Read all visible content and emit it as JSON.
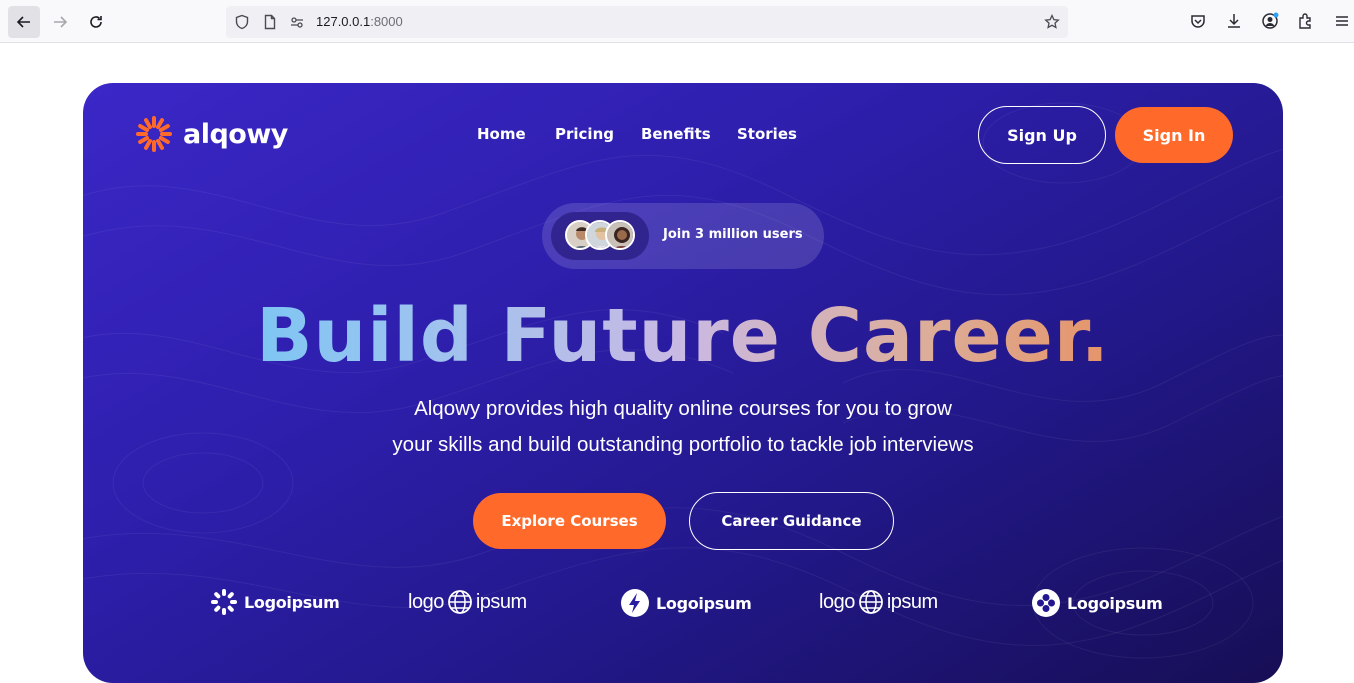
{
  "browser": {
    "url_host": "127.0.0.1",
    "url_port": ":8000"
  },
  "brand": {
    "name": "alqowy",
    "accent": "#ff6a2b"
  },
  "nav": {
    "items": [
      "Home",
      "Pricing",
      "Benefits",
      "Stories"
    ]
  },
  "auth": {
    "signup": "Sign Up",
    "signin": "Sign In"
  },
  "badge": {
    "text": "Join 3 million users"
  },
  "hero": {
    "title_words": [
      "Build",
      "Future",
      "Career."
    ],
    "subtitle_lines": [
      "Alqowy provides high quality online courses for you to grow",
      "your skills and build outstanding portfolio to tackle job interviews"
    ],
    "primary_cta": "Explore Courses",
    "secondary_cta": "Career Guidance"
  },
  "partners": [
    {
      "label": "Logoipsum",
      "icon": "sunburst-icon"
    },
    {
      "label_left": "logo",
      "label_right": "ipsum",
      "icon": "globe-icon"
    },
    {
      "label": "Logoipsum",
      "icon": "bolt-icon"
    },
    {
      "label_left": "logo",
      "label_right": "ipsum",
      "icon": "globe-icon"
    },
    {
      "label": "Logoipsum",
      "icon": "clover-icon"
    }
  ]
}
